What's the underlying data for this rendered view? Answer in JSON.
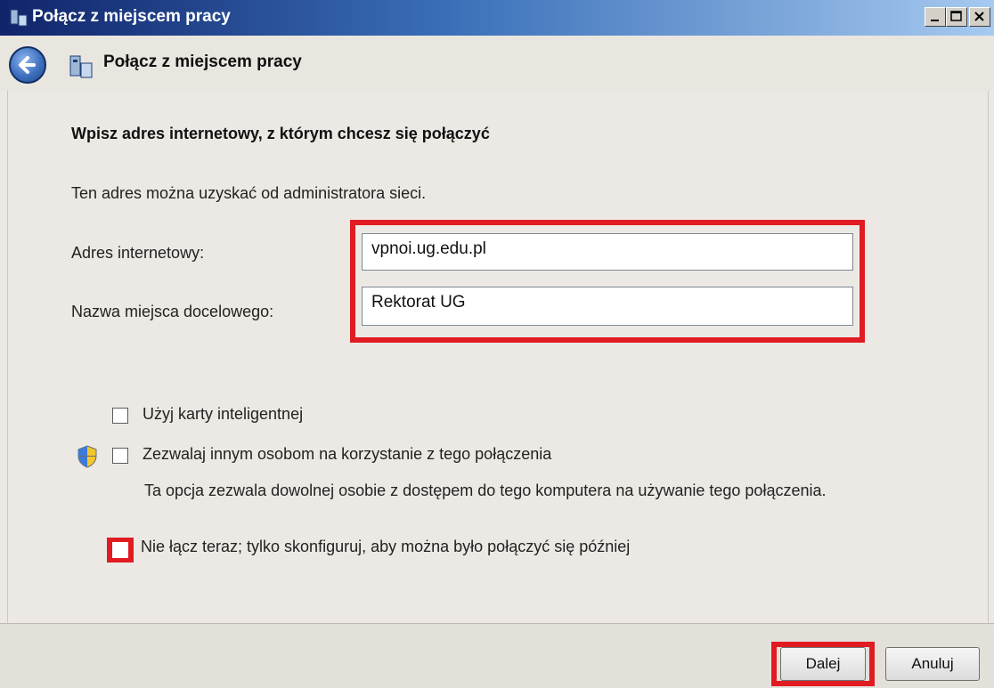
{
  "window": {
    "title": "Połącz z miejscem pracy"
  },
  "nav": {
    "title": "Połącz z miejscem pracy"
  },
  "main": {
    "heading": "Wpisz adres internetowy, z którym chcesz się połączyć",
    "description": "Ten adres można uzyskać od administratora sieci.",
    "address_label": "Adres internetowy:",
    "address_value": "vpnoi.ug.edu.pl",
    "destination_label": "Nazwa miejsca docelowego:",
    "destination_value": "Rektorat UG",
    "options": {
      "smart_card": "Użyj karty inteligentnej",
      "allow_others": "Zezwalaj innym osobom na korzystanie z tego połączenia",
      "allow_others_note": "Ta opcja zezwala dowolnej osobie z dostępem do tego komputera na używanie tego połączenia.",
      "dont_connect": "Nie łącz teraz; tylko skonfiguruj, aby można było połączyć się później"
    }
  },
  "footer": {
    "next": "Dalej",
    "cancel": "Anuluj"
  },
  "colors": {
    "highlight": "#e11b22",
    "titlebar": "#10246a"
  },
  "icons": [
    "network-icon",
    "back-arrow-icon",
    "minimize-icon",
    "maximize-icon",
    "close-icon",
    "uac-shield-icon"
  ]
}
